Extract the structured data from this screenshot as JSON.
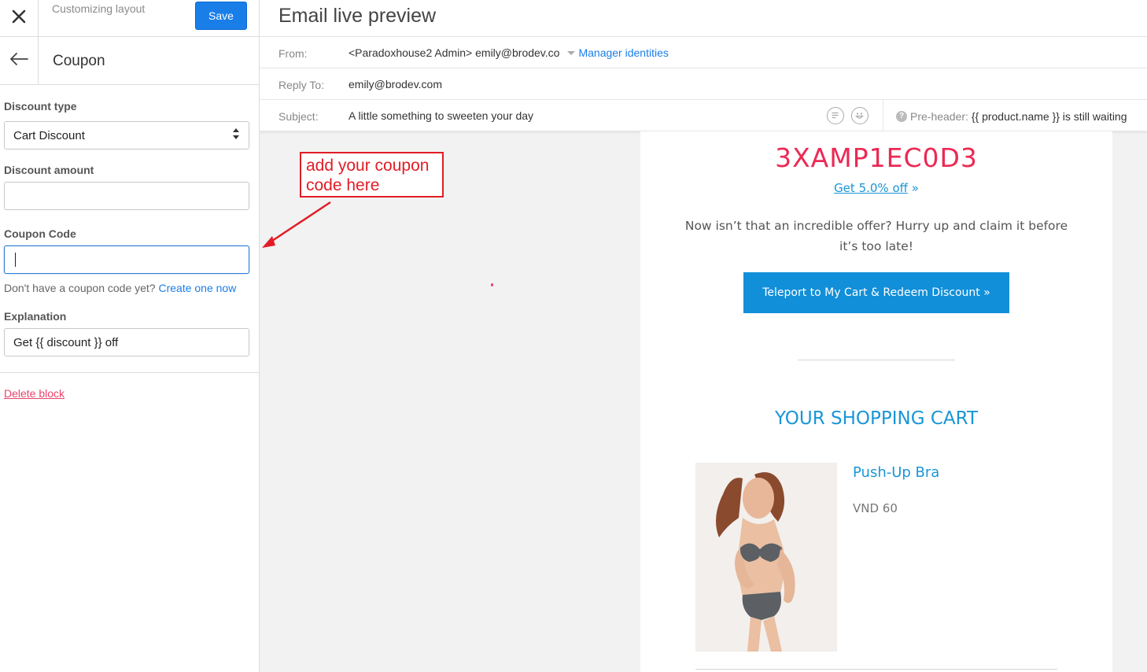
{
  "sidebar": {
    "top_title": "Customizing layout",
    "save_label": "Save",
    "section_title": "Coupon",
    "fields": {
      "discount_type_label": "Discount type",
      "discount_type_value": "Cart Discount",
      "discount_amount_label": "Discount amount",
      "discount_amount_value": "",
      "coupon_code_label": "Coupon Code",
      "coupon_code_value": "",
      "help_text": "Don't have a coupon code yet?",
      "help_link": "Create one now",
      "explanation_label": "Explanation",
      "explanation_value": "Get {{ discount }} off"
    },
    "delete_label": "Delete block"
  },
  "preview": {
    "title": "Email live preview",
    "from_label": "From:",
    "from_value": "<Paradoxhouse2 Admin> emily@brodev.co",
    "manage_identities": "Manager identities",
    "reply_label": "Reply To:",
    "reply_value": "emily@brodev.com",
    "subject_label": "Subject:",
    "subject_value": "A little something to sweeten your day",
    "preheader_label": "Pre-header:",
    "preheader_value": "{{ product.name }} is still waiting"
  },
  "email": {
    "coupon_code": "3XAMP1EC0D3",
    "get_off": "Get 5.0% off",
    "get_off_suffix": "»",
    "offer_text": "Now isn’t that an incredible offer? Hurry up and claim it before it’s too late!",
    "redeem_button": "Teleport to My Cart & Redeem Discount  »",
    "cart_title": "YOUR SHOPPING CART",
    "product_name": "Push-Up Bra",
    "product_price": "VND 60"
  },
  "annotation": {
    "text": "add your coupon\ncode here"
  },
  "colors": {
    "accent_blue": "#1a7ee8",
    "email_blue": "#1a96d6",
    "coupon_pink": "#ec2954",
    "annotation_red": "#e11d25"
  }
}
